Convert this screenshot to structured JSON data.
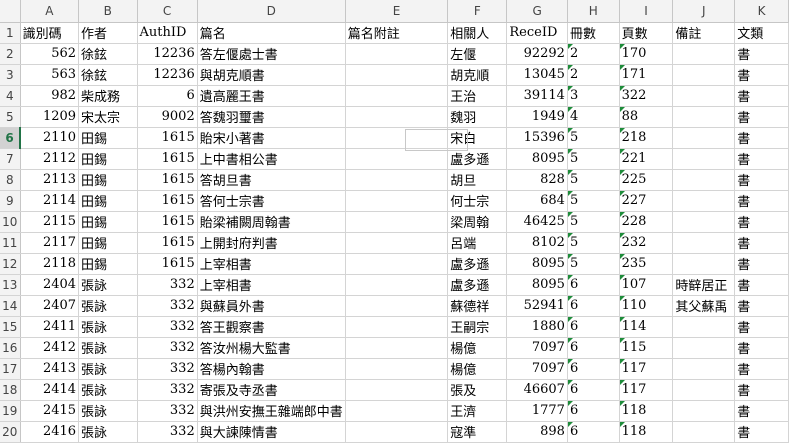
{
  "columns": [
    "A",
    "B",
    "C",
    "D",
    "E",
    "F",
    "G",
    "H",
    "I",
    "J",
    "K"
  ],
  "rows": [
    {
      "n": "1",
      "a": "識別碼",
      "b": "作者",
      "c": "AuthID",
      "d": "篇名",
      "e": "篇名附註",
      "f": "相關人",
      "g": "ReceID",
      "h": "冊數",
      "i": "頁數",
      "j": "備註",
      "k": "文類",
      "header": true
    },
    {
      "n": "2",
      "a": "562",
      "b": "徐鉉",
      "c": "12236",
      "d": "答左偃處士書",
      "e": "",
      "f": "左偃",
      "g": "92292",
      "h": "2",
      "i": "170",
      "j": "",
      "k": "書"
    },
    {
      "n": "3",
      "a": "563",
      "b": "徐鉉",
      "c": "12236",
      "d": "與胡克順書",
      "e": "",
      "f": "胡克順",
      "g": "13045",
      "h": "2",
      "i": "171",
      "j": "",
      "k": "書"
    },
    {
      "n": "4",
      "a": "982",
      "b": "柴成務",
      "c": "6",
      "d": "遺高麗王書",
      "e": "",
      "f": "王治",
      "g": "39114",
      "h": "3",
      "i": "322",
      "j": "",
      "k": "書",
      "red": true
    },
    {
      "n": "5",
      "a": "1209",
      "b": "宋太宗",
      "c": "9002",
      "d": "答魏羽璽書",
      "e": "",
      "f": "魏羽",
      "g": "1949",
      "h": "4",
      "i": "88",
      "j": "",
      "k": "書",
      "gred": true
    },
    {
      "n": "6",
      "a": "2110",
      "b": "田錫",
      "c": "1615",
      "d": "貽宋小著書",
      "e": "",
      "f": "宋白",
      "g": "15396",
      "h": "5",
      "i": "218",
      "j": "",
      "k": "書",
      "fred": true,
      "active": true
    },
    {
      "n": "7",
      "a": "2112",
      "b": "田錫",
      "c": "1615",
      "d": "上中書相公書",
      "e": "",
      "f": "盧多遜",
      "g": "8095",
      "h": "5",
      "i": "221",
      "j": "",
      "k": "書",
      "red": true
    },
    {
      "n": "8",
      "a": "2113",
      "b": "田錫",
      "c": "1615",
      "d": "答胡旦書",
      "e": "",
      "f": "胡旦",
      "g": "828",
      "h": "5",
      "i": "225",
      "j": "",
      "k": "書"
    },
    {
      "n": "9",
      "a": "2114",
      "b": "田錫",
      "c": "1615",
      "d": "答何士宗書",
      "e": "",
      "f": "何士宗",
      "g": "684",
      "h": "5",
      "i": "227",
      "j": "",
      "k": "書"
    },
    {
      "n": "10",
      "a": "2115",
      "b": "田錫",
      "c": "1615",
      "d": "貽梁補闕周翰書",
      "e": "",
      "f": "梁周翰",
      "g": "46425",
      "h": "5",
      "i": "228",
      "j": "",
      "k": "書"
    },
    {
      "n": "11",
      "a": "2117",
      "b": "田錫",
      "c": "1615",
      "d": "上開封府判書",
      "e": "",
      "f": "呂端",
      "g": "8102",
      "h": "5",
      "i": "232",
      "j": "",
      "k": "書",
      "red": true
    },
    {
      "n": "12",
      "a": "2118",
      "b": "田錫",
      "c": "1615",
      "d": "上宰相書",
      "e": "",
      "f": "盧多遜",
      "g": "8095",
      "h": "5",
      "i": "235",
      "j": "",
      "k": "書",
      "red": true
    },
    {
      "n": "13",
      "a": "2404",
      "b": "張詠",
      "c": "332",
      "d": "上宰相書",
      "e": "",
      "f": "盧多遜",
      "g": "8095",
      "h": "6",
      "i": "107",
      "j": "時辥居正",
      "k": "書",
      "red": true
    },
    {
      "n": "14",
      "a": "2407",
      "b": "張詠",
      "c": "332",
      "d": "與蘇員外書",
      "e": "",
      "f": "蘇德祥",
      "g": "52941",
      "h": "6",
      "i": "110",
      "j": "其父蘇禹",
      "k": "書",
      "red": true
    },
    {
      "n": "15",
      "a": "2411",
      "b": "張詠",
      "c": "332",
      "d": "答王觀察書",
      "e": "",
      "f": "王嗣宗",
      "g": "1880",
      "h": "6",
      "i": "114",
      "j": "",
      "k": "書",
      "red": true
    },
    {
      "n": "16",
      "a": "2412",
      "b": "張詠",
      "c": "332",
      "d": "答汝州楊大監書",
      "e": "",
      "f": "楊億",
      "g": "7097",
      "h": "6",
      "i": "115",
      "j": "",
      "k": "書",
      "red": true
    },
    {
      "n": "17",
      "a": "2413",
      "b": "張詠",
      "c": "332",
      "d": "答楊內翰書",
      "e": "",
      "f": "楊億",
      "g": "7097",
      "h": "6",
      "i": "117",
      "j": "",
      "k": "書",
      "red": true
    },
    {
      "n": "18",
      "a": "2414",
      "b": "張詠",
      "c": "332",
      "d": "寄張及寺丞書",
      "e": "",
      "f": "張及",
      "g": "46607",
      "h": "6",
      "i": "117",
      "j": "",
      "k": "書"
    },
    {
      "n": "19",
      "a": "2415",
      "b": "張詠",
      "c": "332",
      "d": "與洪州安撫王雜端郎中書",
      "e": "",
      "f": "王濟",
      "g": "1777",
      "h": "6",
      "i": "118",
      "j": "",
      "k": "書",
      "red": true
    },
    {
      "n": "20",
      "a": "2416",
      "b": "張詠",
      "c": "332",
      "d": "與大諫陳情書",
      "e": "",
      "f": "寇準",
      "g": "898",
      "h": "6",
      "i": "118",
      "j": "",
      "k": "書",
      "red": true
    }
  ],
  "colors": {
    "red": "#e0201e",
    "header_bg": "#f3f3f3",
    "active_accent": "#217346",
    "triangle": "#1e8c3a"
  }
}
